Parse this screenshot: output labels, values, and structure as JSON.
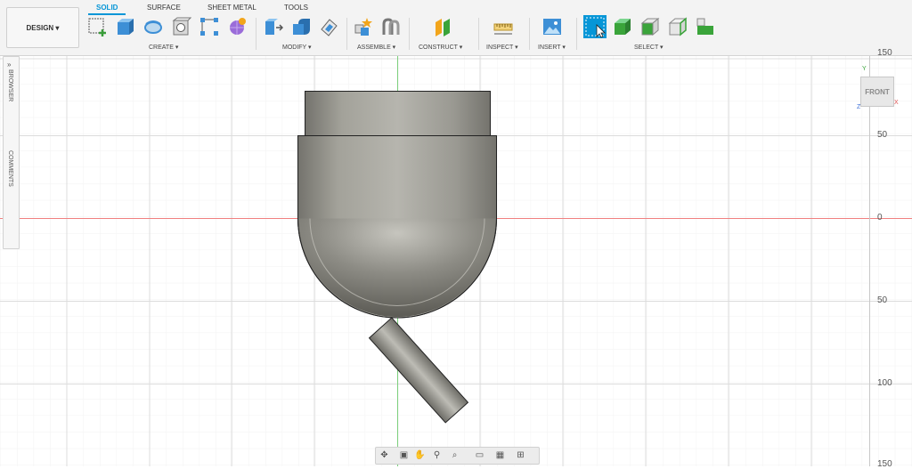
{
  "toolbar": {
    "design_label": "DESIGN ▾",
    "tabs": [
      "SOLID",
      "SURFACE",
      "SHEET METAL",
      "TOOLS"
    ],
    "groups": [
      "CREATE ▾",
      "MODIFY ▾",
      "ASSEMBLE ▾",
      "CONSTRUCT ▾",
      "INSPECT ▾",
      "INSERT ▾",
      "SELECT ▾"
    ]
  },
  "side_panel": {
    "browser": "BROWSER",
    "comments": "COMMENTS"
  },
  "viewcube": {
    "face": "FRONT",
    "axes": [
      "Y",
      "Z",
      "X"
    ]
  },
  "ruler": [
    "150",
    "50",
    "0",
    "50",
    "100",
    "150"
  ],
  "colors": {
    "accent": "#0696d7",
    "toolbar_bg": "#f3f3f3",
    "grid": "#e6e6e6",
    "x_axis": "#f08080",
    "y_axis": "#7dcf7d",
    "model_gray": "#8e8d86"
  },
  "navbar": {
    "icons": [
      "orbit-icon",
      "look-at-icon",
      "pan-icon",
      "zoom-icon",
      "fit-icon",
      "display-settings-icon",
      "grid-icon",
      "viewports-icon"
    ]
  }
}
